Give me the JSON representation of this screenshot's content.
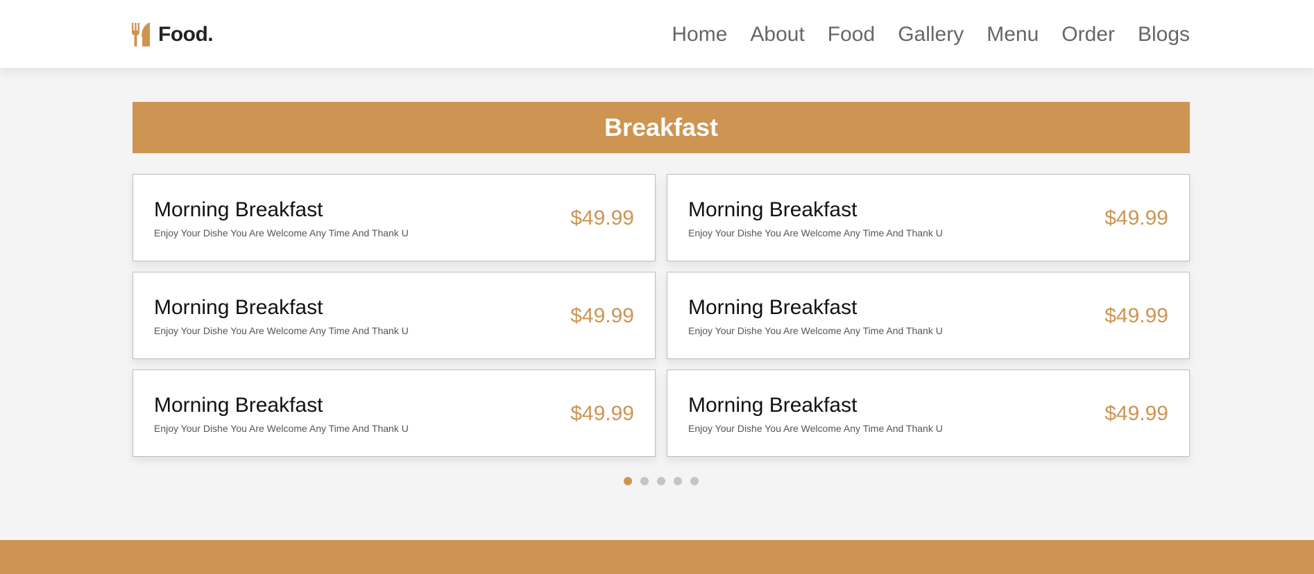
{
  "brand": {
    "name": "Food.",
    "icon": "utensils-icon",
    "color": "#cd9452"
  },
  "nav": {
    "items": [
      {
        "label": "Home"
      },
      {
        "label": "About"
      },
      {
        "label": "Food"
      },
      {
        "label": "Gallery"
      },
      {
        "label": "Menu"
      },
      {
        "label": "Order"
      },
      {
        "label": "Blogs"
      }
    ]
  },
  "menu": {
    "title": "Breakfast",
    "items": [
      {
        "name": "Morning Breakfast",
        "description": "Enjoy Your Dishe You Are Welcome Any Time And Thank U",
        "price": "$49.99"
      },
      {
        "name": "Morning Breakfast",
        "description": "Enjoy Your Dishe You Are Welcome Any Time And Thank U",
        "price": "$49.99"
      },
      {
        "name": "Morning Breakfast",
        "description": "Enjoy Your Dishe You Are Welcome Any Time And Thank U",
        "price": "$49.99"
      },
      {
        "name": "Morning Breakfast",
        "description": "Enjoy Your Dishe You Are Welcome Any Time And Thank U",
        "price": "$49.99"
      },
      {
        "name": "Morning Breakfast",
        "description": "Enjoy Your Dishe You Are Welcome Any Time And Thank U",
        "price": "$49.99"
      },
      {
        "name": "Morning Breakfast",
        "description": "Enjoy Your Dishe You Are Welcome Any Time And Thank U",
        "price": "$49.99"
      }
    ]
  },
  "pagination": {
    "total": 5,
    "active": 1
  }
}
